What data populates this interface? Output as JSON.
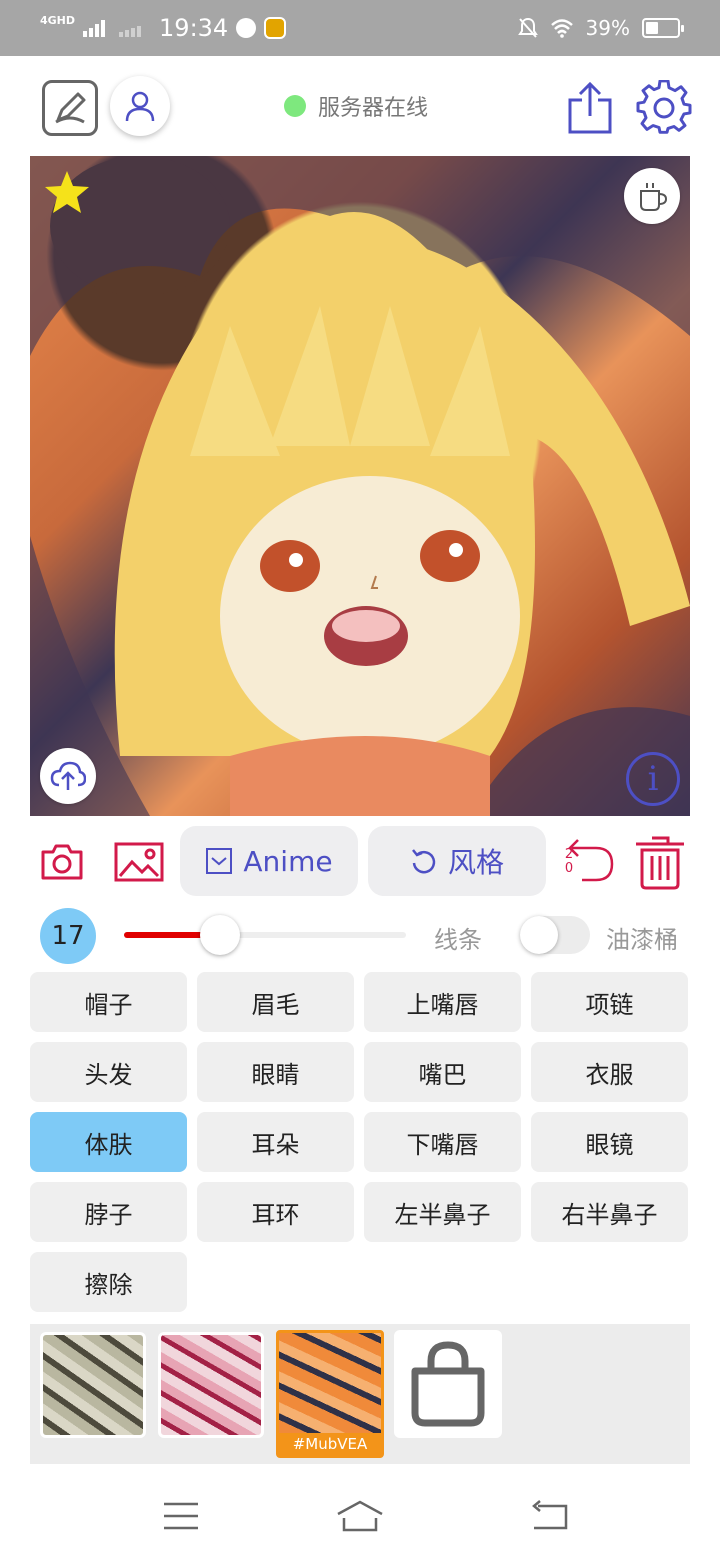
{
  "status_bar": {
    "network": "4GHD",
    "time": "19:34",
    "battery": "39%"
  },
  "header": {
    "server_status": "服务器在线",
    "server_status_color": "#7ee87e"
  },
  "toolbar": {
    "anime_label": "Anime",
    "style_label": "风格",
    "undo_count_top": "2",
    "undo_count_bottom": "0"
  },
  "brush": {
    "size": "17",
    "slider_fraction": 0.34,
    "line_label": "线条",
    "bucket_label": "油漆桶",
    "bucket_enabled": false
  },
  "parts": [
    {
      "label": "帽子",
      "active": false
    },
    {
      "label": "眉毛",
      "active": false
    },
    {
      "label": "上嘴唇",
      "active": false
    },
    {
      "label": "项链",
      "active": false
    },
    {
      "label": "头发",
      "active": false
    },
    {
      "label": "眼睛",
      "active": false
    },
    {
      "label": "嘴巴",
      "active": false
    },
    {
      "label": "衣服",
      "active": false
    },
    {
      "label": "体肤",
      "active": true
    },
    {
      "label": "耳朵",
      "active": false
    },
    {
      "label": "下嘴唇",
      "active": false
    },
    {
      "label": "眼镜",
      "active": false
    },
    {
      "label": "脖子",
      "active": false
    },
    {
      "label": "耳环",
      "active": false
    },
    {
      "label": "左半鼻子",
      "active": false
    },
    {
      "label": "右半鼻子",
      "active": false
    },
    {
      "label": "擦除",
      "active": false
    }
  ],
  "styles": {
    "selected_label": "#MubVEA"
  },
  "colors": {
    "accent": "#4d4fc4",
    "danger": "#d21a4a",
    "active_part": "#7ecaf6",
    "selected_style": "#f39419"
  }
}
